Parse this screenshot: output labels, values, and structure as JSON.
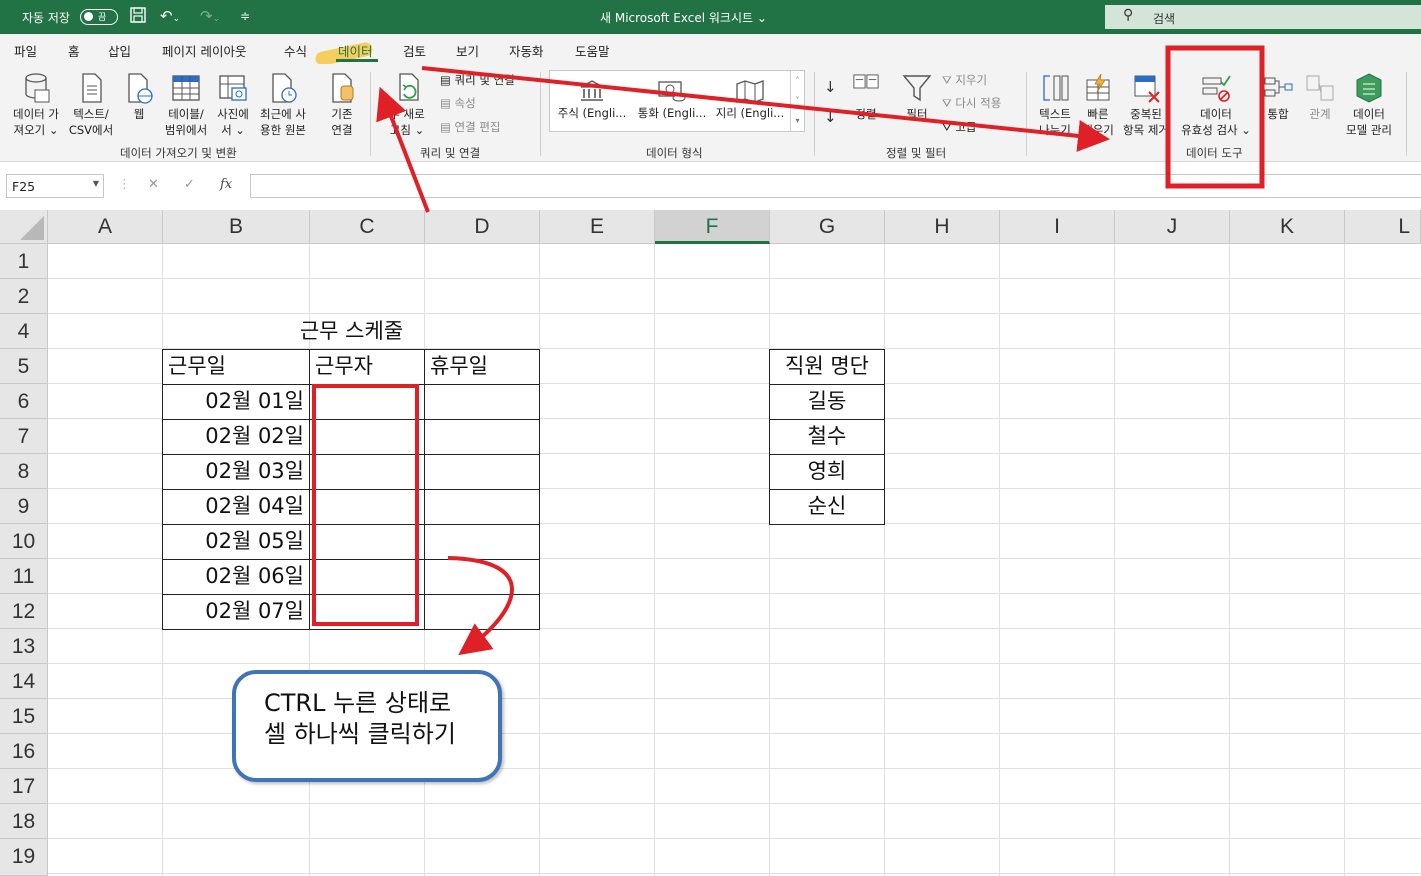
{
  "titlebar": {
    "autosave_label": "자동 저장",
    "autosave_state": "끔",
    "doc_title": "새 Microsoft Excel 워크시트 ⌄",
    "search_placeholder": "검색"
  },
  "ribbon_tabs": [
    "파일",
    "홈",
    "삽입",
    "페이지 레이아웃",
    "수식",
    "데이터",
    "검토",
    "보기",
    "자동화",
    "도움말"
  ],
  "active_tab": "데이터",
  "ribbon": {
    "get_data": {
      "b1": "데이터 가",
      "b1b": "져오기 ⌄",
      "b2": "텍스트/",
      "b2b": "CSV에서",
      "b3": "웹",
      "b4": "테이블/",
      "b4b": "범위에서",
      "b5": "사진에",
      "b5b": "서 ⌄",
      "b6": "최근에 사",
      "b6b": "용한 원본",
      "b7": "기존",
      "b7b": "연결",
      "group": "데이터 가져오기 및 변환"
    },
    "queries": {
      "refresh": "두 새로",
      "refresh_b": "고침 ⌄",
      "q1": "쿼리 및 연결",
      "q2": "속성",
      "q3": "연결 편집",
      "group": "쿼리 및 연결"
    },
    "data_types": {
      "stocks": "주식 (Engli...",
      "currency": "통화 (Engli...",
      "geo": "지리 (Engli...",
      "group": "데이터 형식"
    },
    "sort_filter": {
      "sort": "정렬",
      "filter": "필터",
      "clear": "지우기",
      "reapply": "다시 적용",
      "advanced": "고급",
      "group": "정렬 및 필터"
    },
    "data_tools": {
      "t1": "텍스트",
      "t1b": "나누기",
      "t2": "빠른",
      "t2b": "채우기",
      "t3": "중복된",
      "t3b": "항목 제거",
      "t4": "데이터",
      "t4b": "유효성 검사 ⌄",
      "t5": "통합",
      "t6": "관계",
      "t7": "데이터",
      "t7b": "모델 관리",
      "group": "데이터 도구"
    }
  },
  "formula_bar": {
    "name_box": "F25",
    "cancel": "✕",
    "enter": "✓",
    "fx": "fx",
    "value": ""
  },
  "columns": [
    "A",
    "B",
    "C",
    "D",
    "E",
    "F",
    "G",
    "H",
    "I",
    "J",
    "K",
    "L"
  ],
  "selected_column": "F",
  "rows": [
    "1",
    "2",
    "4",
    "5",
    "6",
    "7",
    "8",
    "9",
    "10",
    "11",
    "12",
    "13",
    "14",
    "15",
    "16",
    "17",
    "18",
    "19"
  ],
  "sheet": {
    "schedule_title": "근무 스케줄",
    "headers": [
      "근무일",
      "근무자",
      "휴무일"
    ],
    "dates": [
      "02월 01일",
      "02월 02일",
      "02월 03일",
      "02월 04일",
      "02월 05일",
      "02월 06일",
      "02월 07일"
    ],
    "staff_title": "직원 명단",
    "staff": [
      "길동",
      "철수",
      "영희",
      "순신"
    ]
  },
  "annotation": {
    "line1": "CTRL 누른 상태로",
    "line2": "셀 하나씩 클릭하기",
    "marker_color": "#e02027",
    "callout_border": "#3f74b7"
  }
}
